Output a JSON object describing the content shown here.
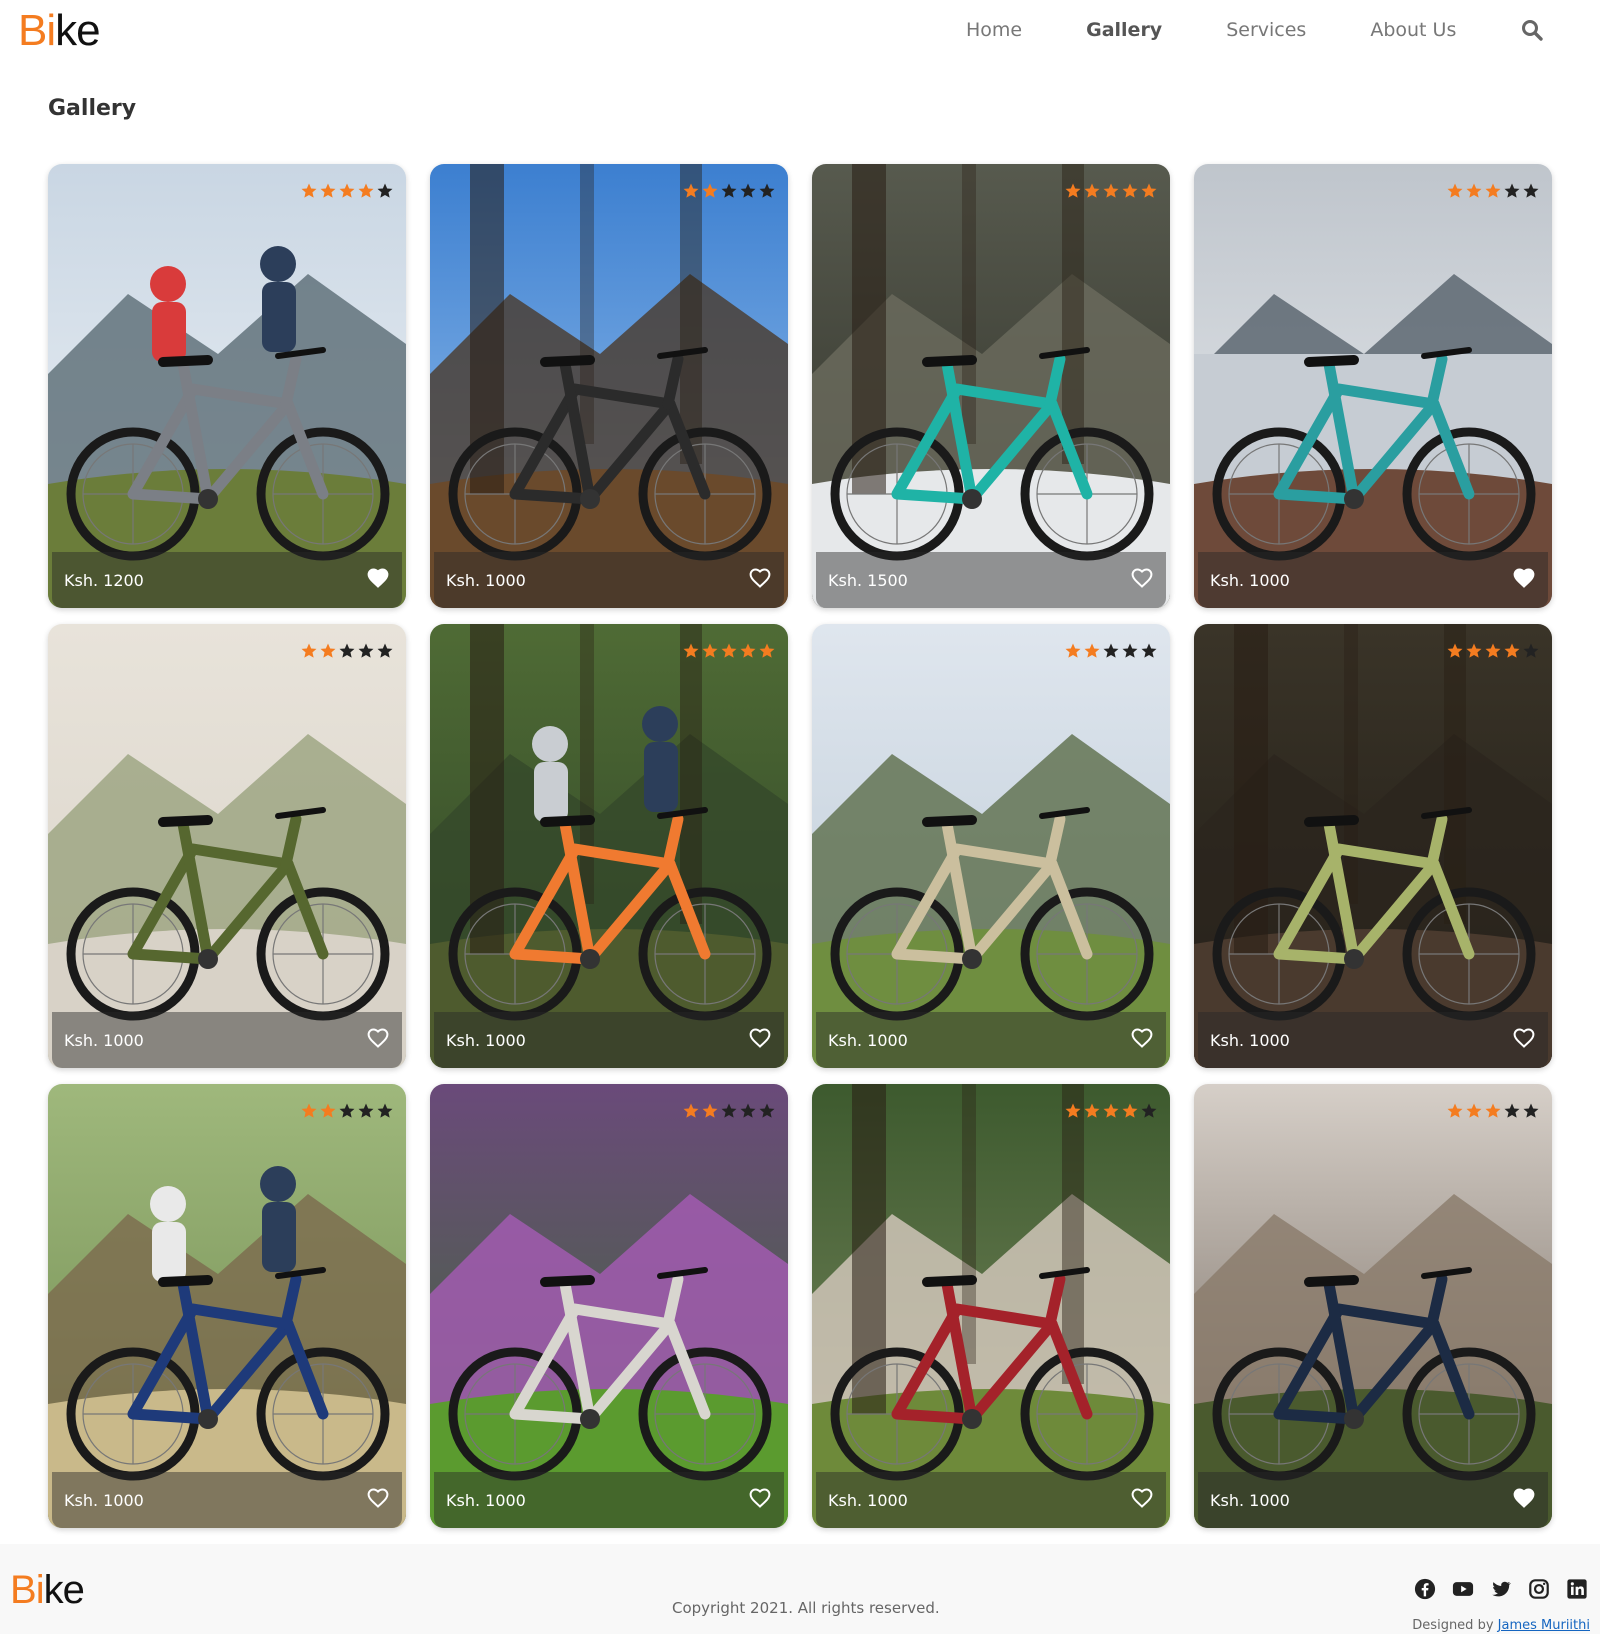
{
  "brand": {
    "logo_b": "B",
    "logo_i": "i",
    "logo_rest": "ke",
    "accent": "#f47c20"
  },
  "nav": {
    "items": [
      {
        "label": "Home",
        "active": false
      },
      {
        "label": "Gallery",
        "active": true
      },
      {
        "label": "Services",
        "active": false
      },
      {
        "label": "About Us",
        "active": false
      }
    ],
    "search_icon": "search-icon"
  },
  "page": {
    "title": "Gallery"
  },
  "gallery": {
    "items": [
      {
        "price": "Ksh. 1200",
        "rating": 4,
        "heart": "filled",
        "scene": "two road cyclists with mountains"
      },
      {
        "price": "Ksh. 1000",
        "rating": 2,
        "heart": "outline",
        "scene": "mountain bike leaning on tree"
      },
      {
        "price": "Ksh. 1500",
        "rating": 5,
        "heart": "outline",
        "scene": "teal bike against tree in snow"
      },
      {
        "price": "Ksh. 1000",
        "rating": 3,
        "heart": "filled",
        "scene": "teal bike by lake"
      },
      {
        "price": "Ksh. 1000",
        "rating": 2,
        "heart": "outline",
        "scene": "green e-bike on path"
      },
      {
        "price": "Ksh. 1000",
        "rating": 5,
        "heart": "outline",
        "scene": "riders jumping in forest"
      },
      {
        "price": "Ksh. 1000",
        "rating": 2,
        "heart": "outline",
        "scene": "beige trail bike on hill"
      },
      {
        "price": "Ksh. 1000",
        "rating": 4,
        "heart": "outline",
        "scene": "lime green bike on dirt"
      },
      {
        "price": "Ksh. 1000",
        "rating": 2,
        "heart": "outline",
        "scene": "two riders on wooden path"
      },
      {
        "price": "Ksh. 1000",
        "rating": 2,
        "heart": "outline",
        "scene": "grey bike by pink flowers"
      },
      {
        "price": "Ksh. 1000",
        "rating": 4,
        "heart": "outline",
        "scene": "red dirt jump bike"
      },
      {
        "price": "Ksh. 1000",
        "rating": 3,
        "heart": "filled",
        "scene": "navy enduro bike mountain backdrop"
      }
    ]
  },
  "footer": {
    "copyright": "Copyright 2021. All rights reserved.",
    "designed_by_prefix": "Designed by ",
    "designer": "James Muriithi",
    "socials": [
      "facebook-icon",
      "youtube-icon",
      "twitter-icon",
      "instagram-icon",
      "linkedin-icon"
    ]
  }
}
